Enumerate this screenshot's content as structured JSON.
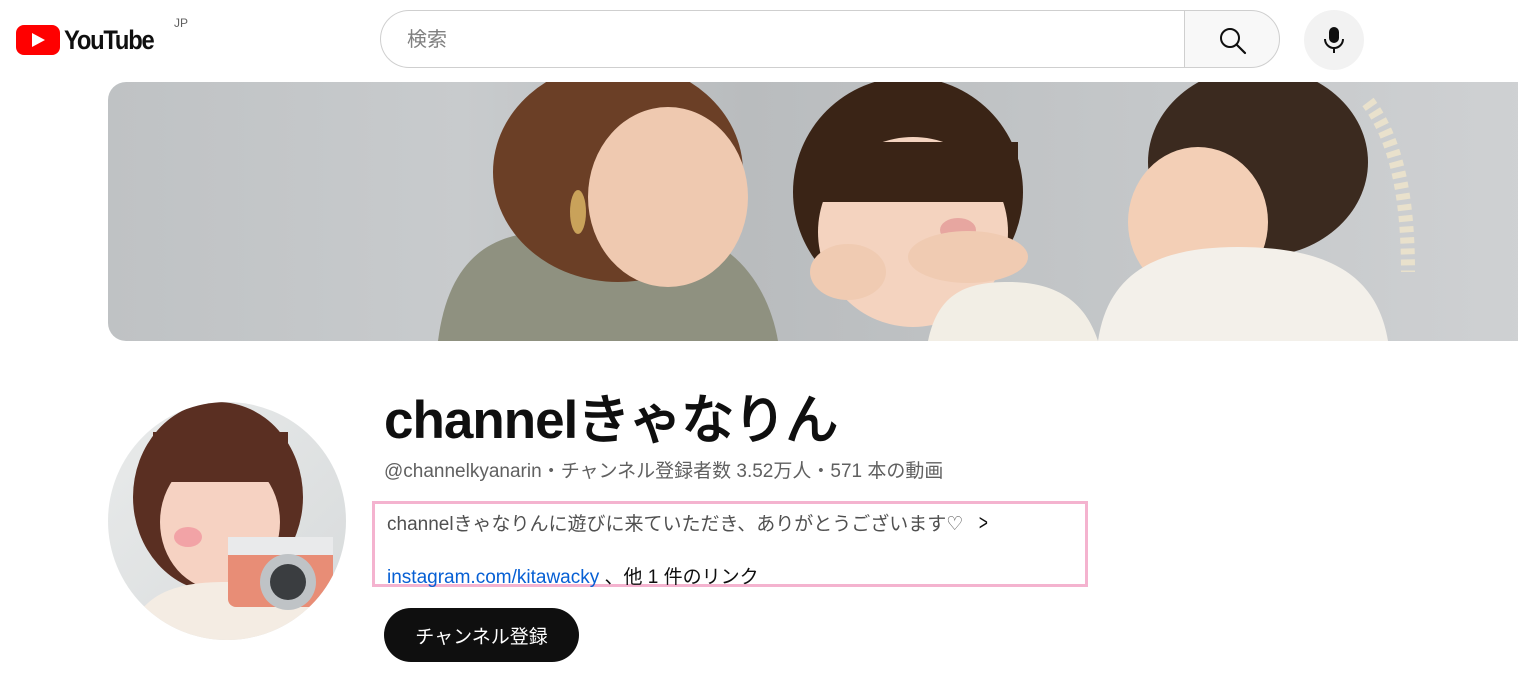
{
  "header": {
    "logo_text": "YouTube",
    "region": "JP",
    "search_placeholder": "検索"
  },
  "channel": {
    "name": "channelきゃなりん",
    "handle": "@channelkyanarin",
    "separator": "・",
    "subscribers": "チャンネル登録者数 3.52万人",
    "video_count": "571 本の動画",
    "description": "channelきゃなりんに遊びに来ていただき、ありがとうございます♡",
    "link_url": "instagram.com/kitawacky",
    "link_more": "、他 1 件のリンク",
    "subscribe_label": "チャンネル登録"
  },
  "colors": {
    "brand": "#ff0000",
    "link": "#065fd4",
    "highlight_border": "#f4b3cf",
    "subscribe_bg": "#0f0f0f"
  },
  "icons": {
    "search": "search-icon",
    "mic": "mic-icon",
    "chevron": "chevron-right-icon"
  }
}
